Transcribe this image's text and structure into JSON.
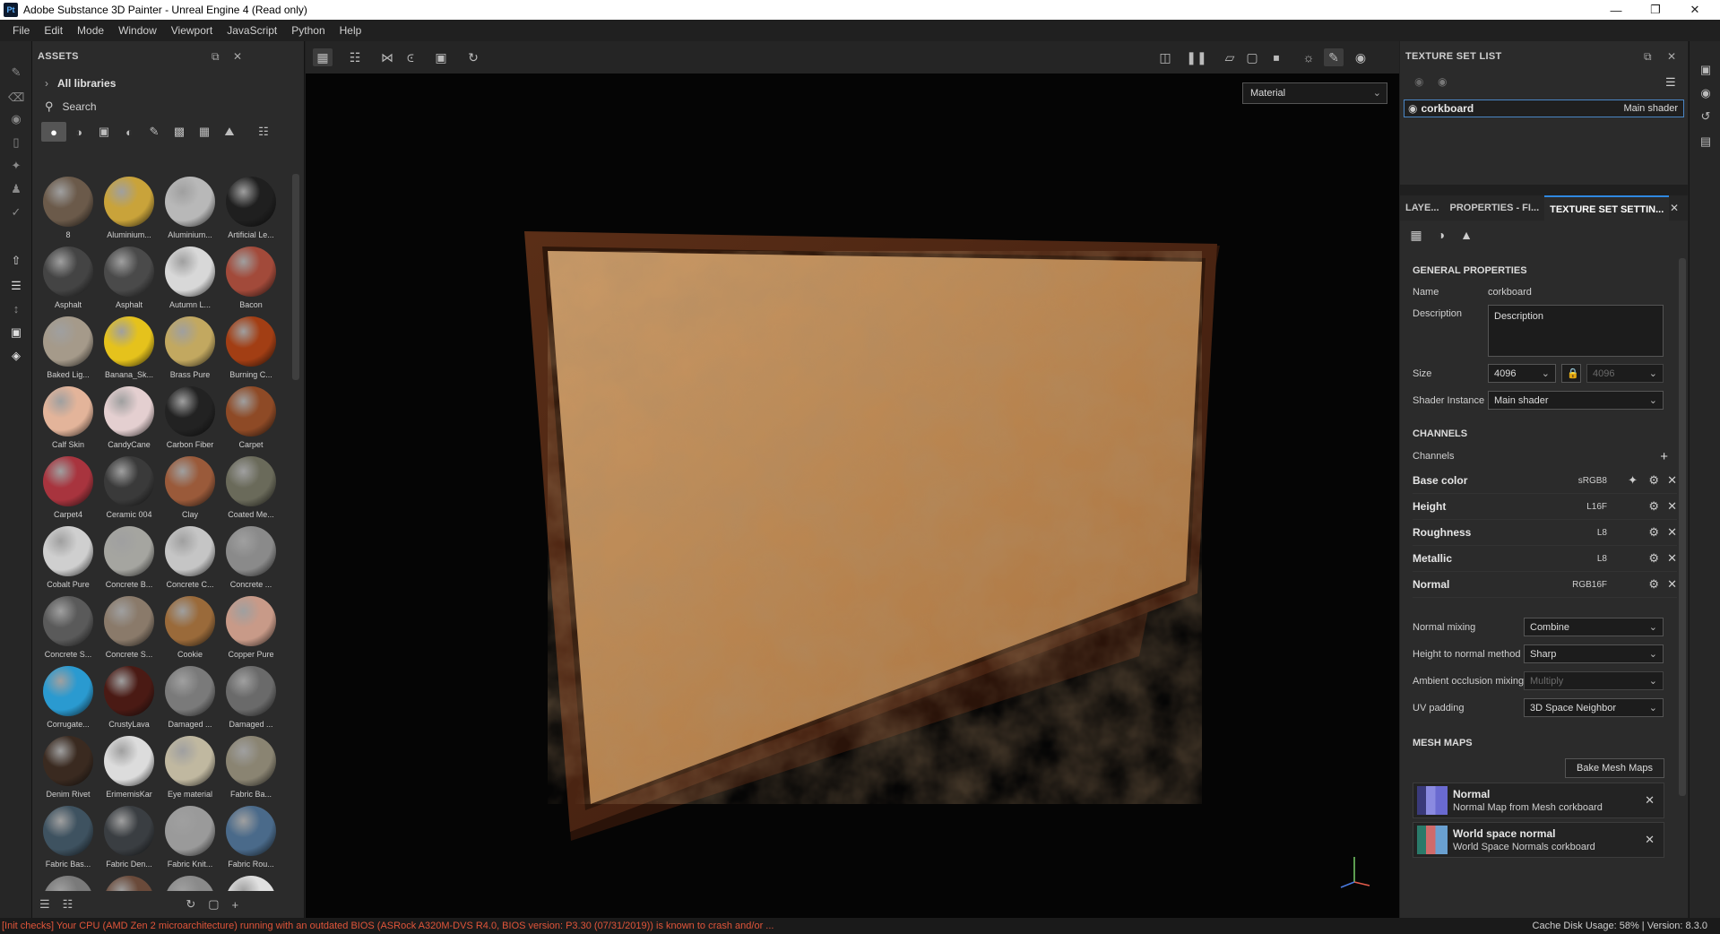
{
  "window": {
    "title": "Adobe Substance 3D Painter - Unreal Engine 4 (Read only)",
    "logo": "Pt"
  },
  "menu": [
    "File",
    "Edit",
    "Mode",
    "Window",
    "Viewport",
    "JavaScript",
    "Python",
    "Help"
  ],
  "assets": {
    "title": "ASSETS",
    "library": "All libraries",
    "search_placeholder": "Search",
    "items": [
      {
        "label": "8",
        "color": "#6b5a4a"
      },
      {
        "label": "Aluminium...",
        "color": "#c9a33a"
      },
      {
        "label": "Aluminium...",
        "color": "#b8b8b8"
      },
      {
        "label": "Artificial Le...",
        "color": "#1f1f1f"
      },
      {
        "label": "Asphalt",
        "color": "#444444"
      },
      {
        "label": "Asphalt",
        "color": "#4a4a4a"
      },
      {
        "label": "Autumn L...",
        "color": "#d8d8d8"
      },
      {
        "label": "Bacon",
        "color": "#a24a3a"
      },
      {
        "label": "Baked Lig...",
        "color": "#a59a8a"
      },
      {
        "label": "Banana_Sk...",
        "color": "#e5c21c"
      },
      {
        "label": "Brass Pure",
        "color": "#c2a860"
      },
      {
        "label": "Burning C...",
        "color": "#a23e14"
      },
      {
        "label": "Calf Skin",
        "color": "#e3b49a"
      },
      {
        "label": "CandyCane",
        "color": "#e4cfd0"
      },
      {
        "label": "Carbon Fiber",
        "color": "#222222"
      },
      {
        "label": "Carpet",
        "color": "#8e4a26"
      },
      {
        "label": "Carpet4",
        "color": "#a8343e"
      },
      {
        "label": "Ceramic 004",
        "color": "#3a3a3a"
      },
      {
        "label": "Clay",
        "color": "#9a5a3a"
      },
      {
        "label": "Coated Me...",
        "color": "#6a6a5a"
      },
      {
        "label": "Cobalt Pure",
        "color": "#cfcfcf"
      },
      {
        "label": "Concrete B...",
        "color": "#a5a5a0"
      },
      {
        "label": "Concrete C...",
        "color": "#c5c5c5"
      },
      {
        "label": "Concrete ...",
        "color": "#8a8a8a"
      },
      {
        "label": "Concrete S...",
        "color": "#5a5a5a"
      },
      {
        "label": "Concrete S...",
        "color": "#8a7a6a"
      },
      {
        "label": "Cookie",
        "color": "#9a6a3a"
      },
      {
        "label": "Copper Pure",
        "color": "#c89a88"
      },
      {
        "label": "Corrugate...",
        "color": "#2a9ad0"
      },
      {
        "label": "CrustyLava",
        "color": "#4a1a14"
      },
      {
        "label": "Damaged ...",
        "color": "#7a7a7a"
      },
      {
        "label": "Damaged ...",
        "color": "#6a6a6a"
      },
      {
        "label": "Denim Rivet",
        "color": "#3a2a20"
      },
      {
        "label": "ErimemisKar",
        "color": "#dcdcdc"
      },
      {
        "label": "Eye material",
        "color": "#c0b8a0"
      },
      {
        "label": "Fabric Ba...",
        "color": "#8a8472"
      },
      {
        "label": "Fabric Bas...",
        "color": "#3e5260"
      },
      {
        "label": "Fabric Den...",
        "color": "#3a3e42"
      },
      {
        "label": "Fabric Knit...",
        "color": "#9a9a9a"
      },
      {
        "label": "Fabric Rou...",
        "color": "#4a6a8a"
      },
      {
        "label": "",
        "color": "#7a7a7a"
      },
      {
        "label": "",
        "color": "#6a4a3a"
      },
      {
        "label": "",
        "color": "#8a8a8a"
      },
      {
        "label": "",
        "color": "#e0e0e0"
      }
    ]
  },
  "viewport": {
    "material_mode": "Material"
  },
  "texture_set_list": {
    "title": "TEXTURE SET LIST",
    "item_name": "corkboard",
    "item_shader": "Main shader"
  },
  "tabs": [
    "LAYE...",
    "PROPERTIES - FI...",
    "TEXTURE SET SETTIN..."
  ],
  "general": {
    "title": "GENERAL PROPERTIES",
    "name_label": "Name",
    "name_value": "corkboard",
    "desc_label": "Description",
    "desc_value": "Description",
    "size_label": "Size",
    "size_value": "4096",
    "size_value2": "4096",
    "shader_label": "Shader Instance",
    "shader_value": "Main shader"
  },
  "channels": {
    "title": "CHANNELS",
    "label": "Channels",
    "items": [
      {
        "name": "Base color",
        "format": "sRGB8"
      },
      {
        "name": "Height",
        "format": "L16F"
      },
      {
        "name": "Roughness",
        "format": "L8"
      },
      {
        "name": "Metallic",
        "format": "L8"
      },
      {
        "name": "Normal",
        "format": "RGB16F"
      }
    ]
  },
  "mixing": {
    "normal_mixing_label": "Normal mixing",
    "normal_mixing_value": "Combine",
    "h2n_label": "Height to normal method",
    "h2n_value": "Sharp",
    "ao_label": "Ambient occlusion mixing",
    "ao_value": "Multiply",
    "uv_label": "UV padding",
    "uv_value": "3D Space Neighbor"
  },
  "mesh_maps": {
    "title": "MESH MAPS",
    "bake_button": "Bake Mesh Maps",
    "items": [
      {
        "name": "Normal",
        "desc": "Normal Map from Mesh corkboard"
      },
      {
        "name": "World space normal",
        "desc": "World Space Normals corkboard"
      }
    ]
  },
  "status": {
    "message": "[Init checks] Your CPU (AMD Zen 2 microarchitecture) running with an outdated BIOS (ASRock A320M-DVS R4.0, BIOS version: P3.30 (07/31/2019)) is known to crash and/or ...",
    "cache": "Cache Disk Usage:   58%  |  Version: 8.3.0"
  }
}
